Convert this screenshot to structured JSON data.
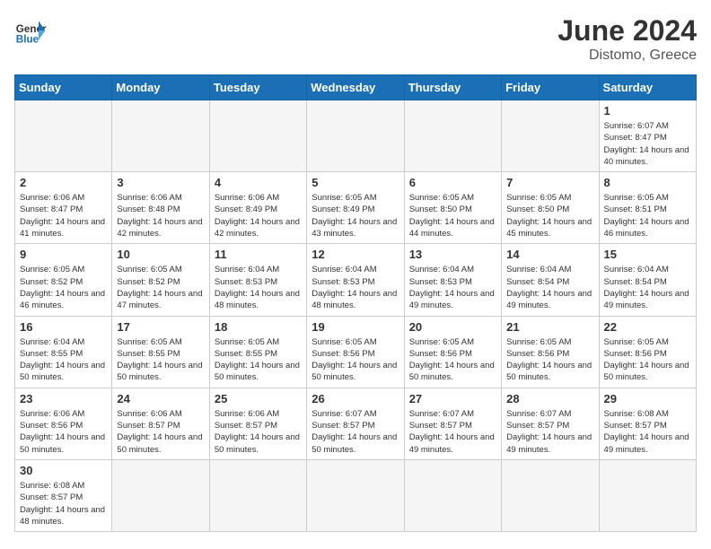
{
  "header": {
    "logo_general": "General",
    "logo_blue": "Blue",
    "month_year": "June 2024",
    "location": "Distomo, Greece"
  },
  "weekdays": [
    "Sunday",
    "Monday",
    "Tuesday",
    "Wednesday",
    "Thursday",
    "Friday",
    "Saturday"
  ],
  "weeks": [
    [
      {
        "day": "",
        "empty": true
      },
      {
        "day": "",
        "empty": true
      },
      {
        "day": "",
        "empty": true
      },
      {
        "day": "",
        "empty": true
      },
      {
        "day": "",
        "empty": true
      },
      {
        "day": "",
        "empty": true
      },
      {
        "day": "1",
        "sunrise": "6:07 AM",
        "sunset": "8:47 PM",
        "daylight": "14 hours and 40 minutes."
      }
    ],
    [
      {
        "day": "2",
        "sunrise": "6:06 AM",
        "sunset": "8:47 PM",
        "daylight": "14 hours and 41 minutes."
      },
      {
        "day": "3",
        "sunrise": "6:06 AM",
        "sunset": "8:48 PM",
        "daylight": "14 hours and 42 minutes."
      },
      {
        "day": "4",
        "sunrise": "6:06 AM",
        "sunset": "8:49 PM",
        "daylight": "14 hours and 42 minutes."
      },
      {
        "day": "5",
        "sunrise": "6:05 AM",
        "sunset": "8:49 PM",
        "daylight": "14 hours and 43 minutes."
      },
      {
        "day": "6",
        "sunrise": "6:05 AM",
        "sunset": "8:50 PM",
        "daylight": "14 hours and 44 minutes."
      },
      {
        "day": "7",
        "sunrise": "6:05 AM",
        "sunset": "8:50 PM",
        "daylight": "14 hours and 45 minutes."
      },
      {
        "day": "8",
        "sunrise": "6:05 AM",
        "sunset": "8:51 PM",
        "daylight": "14 hours and 46 minutes."
      }
    ],
    [
      {
        "day": "9",
        "sunrise": "6:05 AM",
        "sunset": "8:52 PM",
        "daylight": "14 hours and 46 minutes."
      },
      {
        "day": "10",
        "sunrise": "6:05 AM",
        "sunset": "8:52 PM",
        "daylight": "14 hours and 47 minutes."
      },
      {
        "day": "11",
        "sunrise": "6:04 AM",
        "sunset": "8:53 PM",
        "daylight": "14 hours and 48 minutes."
      },
      {
        "day": "12",
        "sunrise": "6:04 AM",
        "sunset": "8:53 PM",
        "daylight": "14 hours and 48 minutes."
      },
      {
        "day": "13",
        "sunrise": "6:04 AM",
        "sunset": "8:53 PM",
        "daylight": "14 hours and 49 minutes."
      },
      {
        "day": "14",
        "sunrise": "6:04 AM",
        "sunset": "8:54 PM",
        "daylight": "14 hours and 49 minutes."
      },
      {
        "day": "15",
        "sunrise": "6:04 AM",
        "sunset": "8:54 PM",
        "daylight": "14 hours and 49 minutes."
      }
    ],
    [
      {
        "day": "16",
        "sunrise": "6:04 AM",
        "sunset": "8:55 PM",
        "daylight": "14 hours and 50 minutes."
      },
      {
        "day": "17",
        "sunrise": "6:05 AM",
        "sunset": "8:55 PM",
        "daylight": "14 hours and 50 minutes."
      },
      {
        "day": "18",
        "sunrise": "6:05 AM",
        "sunset": "8:55 PM",
        "daylight": "14 hours and 50 minutes."
      },
      {
        "day": "19",
        "sunrise": "6:05 AM",
        "sunset": "8:56 PM",
        "daylight": "14 hours and 50 minutes."
      },
      {
        "day": "20",
        "sunrise": "6:05 AM",
        "sunset": "8:56 PM",
        "daylight": "14 hours and 50 minutes."
      },
      {
        "day": "21",
        "sunrise": "6:05 AM",
        "sunset": "8:56 PM",
        "daylight": "14 hours and 50 minutes."
      },
      {
        "day": "22",
        "sunrise": "6:05 AM",
        "sunset": "8:56 PM",
        "daylight": "14 hours and 50 minutes."
      }
    ],
    [
      {
        "day": "23",
        "sunrise": "6:06 AM",
        "sunset": "8:56 PM",
        "daylight": "14 hours and 50 minutes."
      },
      {
        "day": "24",
        "sunrise": "6:06 AM",
        "sunset": "8:57 PM",
        "daylight": "14 hours and 50 minutes."
      },
      {
        "day": "25",
        "sunrise": "6:06 AM",
        "sunset": "8:57 PM",
        "daylight": "14 hours and 50 minutes."
      },
      {
        "day": "26",
        "sunrise": "6:07 AM",
        "sunset": "8:57 PM",
        "daylight": "14 hours and 50 minutes."
      },
      {
        "day": "27",
        "sunrise": "6:07 AM",
        "sunset": "8:57 PM",
        "daylight": "14 hours and 49 minutes."
      },
      {
        "day": "28",
        "sunrise": "6:07 AM",
        "sunset": "8:57 PM",
        "daylight": "14 hours and 49 minutes."
      },
      {
        "day": "29",
        "sunrise": "6:08 AM",
        "sunset": "8:57 PM",
        "daylight": "14 hours and 49 minutes."
      }
    ],
    [
      {
        "day": "30",
        "sunrise": "6:08 AM",
        "sunset": "8:57 PM",
        "daylight": "14 hours and 48 minutes."
      },
      {
        "day": "",
        "empty": true
      },
      {
        "day": "",
        "empty": true
      },
      {
        "day": "",
        "empty": true
      },
      {
        "day": "",
        "empty": true
      },
      {
        "day": "",
        "empty": true
      },
      {
        "day": "",
        "empty": true
      }
    ]
  ]
}
